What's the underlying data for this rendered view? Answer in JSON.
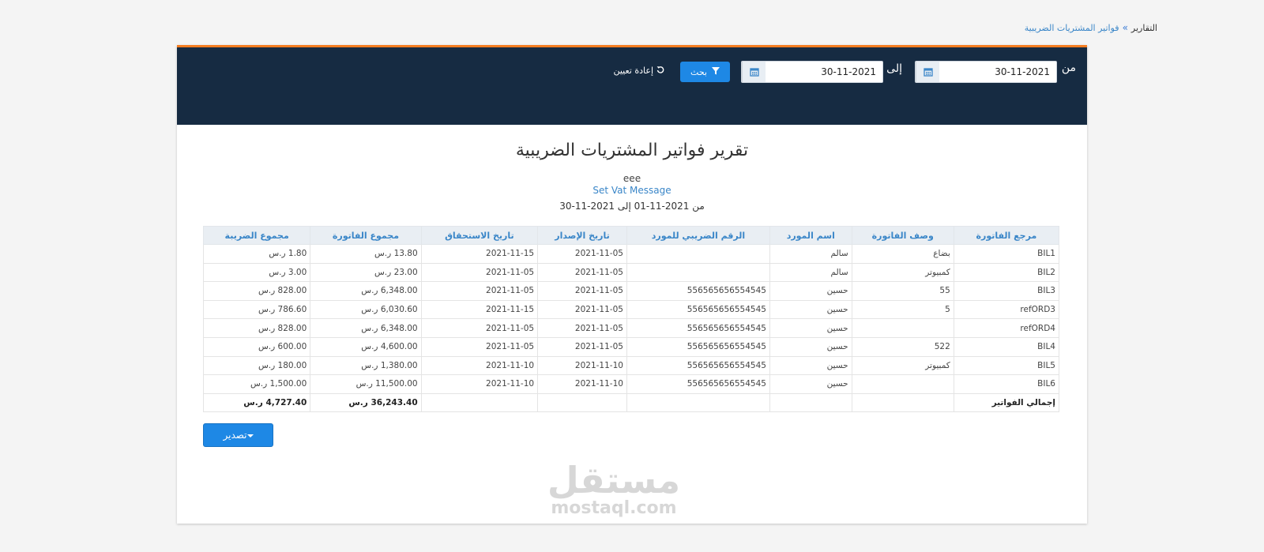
{
  "breadcrumb": {
    "root": "التقارير",
    "separator": "»",
    "current": "فواتير المشتريات الضريبية"
  },
  "filter": {
    "from_label": "من",
    "to_label": "إلى",
    "from_date": "30-11-2021",
    "to_date": "30-11-2021",
    "search_label": "بحث",
    "reset_label": "إعادة تعيين"
  },
  "report": {
    "title": "تقرير فواتير المشتريات الضريبية",
    "company": "eee",
    "vat_message": "Set Vat Message",
    "period": "من 2021-11-01 إلى 2021-11-30"
  },
  "table": {
    "headers": [
      "مرجع الفاتورة",
      "وصف الفاتورة",
      "اسم المورد",
      "الرقم الضريبي للمورد",
      "تاريخ الإصدار",
      "تاريخ الاستحقاق",
      "مجموع الفاتورة",
      "مجموع الضريبة"
    ],
    "rows": [
      [
        "BIL1",
        "بضاع",
        "سالم",
        "",
        "2021-11-05",
        "2021-11-15",
        "13.80 ر.س",
        "1.80 ر.س"
      ],
      [
        "BIL2",
        "كمبيوتر",
        "سالم",
        "",
        "2021-11-05",
        "2021-11-05",
        "23.00 ر.س",
        "3.00 ر.س"
      ],
      [
        "BIL3",
        "55",
        "حسين",
        "556565656554545",
        "2021-11-05",
        "2021-11-05",
        "6,348.00 ر.س",
        "828.00 ر.س"
      ],
      [
        "refORD3",
        "5",
        "حسين",
        "556565656554545",
        "2021-11-05",
        "2021-11-15",
        "6,030.60 ر.س",
        "786.60 ر.س"
      ],
      [
        "refORD4",
        "",
        "حسين",
        "556565656554545",
        "2021-11-05",
        "2021-11-05",
        "6,348.00 ر.س",
        "828.00 ر.س"
      ],
      [
        "BIL4",
        "522",
        "حسين",
        "556565656554545",
        "2021-11-05",
        "2021-11-05",
        "4,600.00 ر.س",
        "600.00 ر.س"
      ],
      [
        "BIL5",
        "كمبيوتر",
        "حسين",
        "556565656554545",
        "2021-11-10",
        "2021-11-10",
        "1,380.00 ر.س",
        "180.00 ر.س"
      ],
      [
        "BIL6",
        "",
        "حسين",
        "556565656554545",
        "2021-11-10",
        "2021-11-10",
        "11,500.00 ر.س",
        "1,500.00 ر.س"
      ]
    ],
    "total": {
      "label": "إجمالي الفواتير",
      "invoice_total": "36,243.40 ر.س",
      "tax_total": "4,727.40 ر.س"
    }
  },
  "export": {
    "label": "تصدير"
  },
  "watermark": {
    "arabic": "مستقل",
    "latin": "mostaql.com"
  },
  "colors": {
    "accent": "#f57c1f",
    "header_bg": "#162b42",
    "primary": "#1e88e5",
    "link": "#3a86c8"
  }
}
